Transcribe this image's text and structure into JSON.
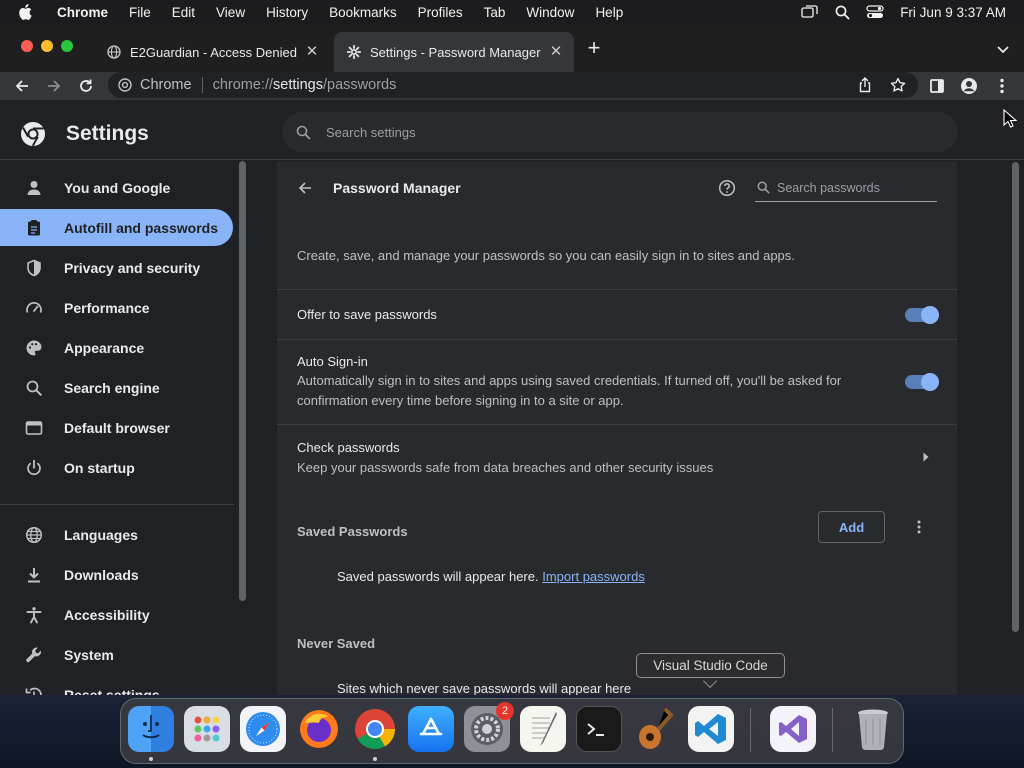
{
  "menubar": {
    "app": "Chrome",
    "items": [
      "File",
      "Edit",
      "View",
      "History",
      "Bookmarks",
      "Profiles",
      "Tab",
      "Window",
      "Help"
    ],
    "clock": "Fri Jun 9  3:37 AM",
    "icons": [
      "screen-mirror-icon",
      "spotlight-search-icon",
      "control-center-icon"
    ]
  },
  "tabs": [
    {
      "title": "E2Guardian - Access Denied",
      "icon": "globe-icon"
    },
    {
      "title": "Settings - Password Manager",
      "icon": "gear-icon"
    }
  ],
  "omnibox": {
    "chip": "Chrome",
    "url_prefix": "chrome://",
    "url_host": "settings",
    "url_path": "/passwords"
  },
  "settings": {
    "title": "Settings",
    "search_placeholder": "Search settings",
    "nav": [
      {
        "label": "You and Google",
        "icon": "person-icon"
      },
      {
        "label": "Autofill and passwords",
        "icon": "clipboard-icon",
        "selected": true
      },
      {
        "label": "Privacy and security",
        "icon": "shield-icon"
      },
      {
        "label": "Performance",
        "icon": "speedometer-icon"
      },
      {
        "label": "Appearance",
        "icon": "palette-icon"
      },
      {
        "label": "Search engine",
        "icon": "search-icon"
      },
      {
        "label": "Default browser",
        "icon": "browser-icon"
      },
      {
        "label": "On startup",
        "icon": "power-icon"
      },
      {
        "label": "Languages",
        "icon": "globe-icon"
      },
      {
        "label": "Downloads",
        "icon": "download-icon"
      },
      {
        "label": "Accessibility",
        "icon": "accessibility-icon"
      },
      {
        "label": "System",
        "icon": "wrench-icon"
      },
      {
        "label": "Reset settings",
        "icon": "history-icon"
      }
    ]
  },
  "password_manager": {
    "title": "Password Manager",
    "search_placeholder": "Search passwords",
    "description": "Create, save, and manage your passwords so you can easily sign in to sites and apps.",
    "offer_to_save": {
      "label": "Offer to save passwords",
      "enabled": true
    },
    "auto_signin": {
      "label": "Auto Sign-in",
      "sub_line1": "Automatically sign in to sites and apps using saved credentials. If turned off, you'll be asked for",
      "sub_line2": "confirmation every time before signing in to a site or app.",
      "enabled": true
    },
    "check_passwords": {
      "label": "Check passwords",
      "sub": "Keep your passwords safe from data breaches and other security issues"
    },
    "saved_passwords": {
      "title": "Saved Passwords",
      "add_label": "Add",
      "empty_text": "Saved passwords will appear here.",
      "import_link": "Import passwords"
    },
    "never_saved": {
      "title": "Never Saved",
      "empty_text": "Sites which never save passwords will appear here"
    }
  },
  "tooltip": "Visual Studio Code",
  "dock": {
    "apps": [
      "Finder",
      "Launchpad",
      "Safari",
      "Firefox",
      "Google Chrome",
      "App Store",
      "System Settings",
      "TextEdit",
      "Terminal",
      "Instruments",
      "Visual Studio Code",
      "Visual Studio",
      "Trash"
    ],
    "system_settings_badge": "2"
  }
}
